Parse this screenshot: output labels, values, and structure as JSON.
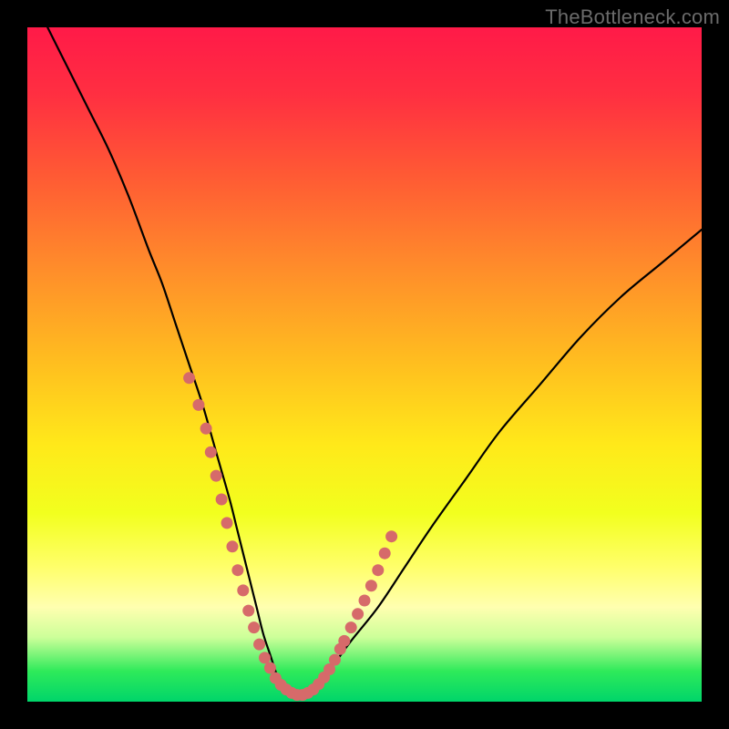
{
  "watermark": "TheBottleneck.com",
  "colors": {
    "frame": "#000000",
    "gradient_stops": [
      {
        "offset": 0.0,
        "color": "#ff1a48"
      },
      {
        "offset": 0.1,
        "color": "#ff2f41"
      },
      {
        "offset": 0.22,
        "color": "#ff5a34"
      },
      {
        "offset": 0.35,
        "color": "#ff8a2b"
      },
      {
        "offset": 0.5,
        "color": "#ffbf1f"
      },
      {
        "offset": 0.62,
        "color": "#ffe91a"
      },
      {
        "offset": 0.72,
        "color": "#f2ff1e"
      },
      {
        "offset": 0.8,
        "color": "#ffff6a"
      },
      {
        "offset": 0.86,
        "color": "#ffffb0"
      },
      {
        "offset": 0.905,
        "color": "#ccff99"
      },
      {
        "offset": 0.955,
        "color": "#2eea5a"
      },
      {
        "offset": 1.0,
        "color": "#00d56a"
      }
    ],
    "curve": "#000000",
    "marker_fill": "#d66a6a",
    "marker_stroke": "#b84f4f"
  },
  "chart_data": {
    "type": "line",
    "title": "",
    "xlabel": "",
    "ylabel": "",
    "xlim": [
      0,
      100
    ],
    "ylim": [
      0,
      100
    ],
    "series": [
      {
        "name": "bottleneck-curve",
        "x": [
          3,
          6,
          9,
          12,
          15,
          18,
          20,
          22,
          24,
          26,
          28,
          30,
          31,
          32,
          33,
          34,
          35,
          36,
          37,
          38,
          39,
          40,
          42,
          45,
          48,
          52,
          56,
          60,
          65,
          70,
          76,
          82,
          88,
          94,
          100
        ],
        "y": [
          100,
          94,
          88,
          82,
          75,
          67,
          62,
          56,
          50,
          44,
          37,
          30,
          26,
          22,
          18,
          14,
          10,
          7,
          4,
          2,
          1,
          1,
          2,
          5,
          9,
          14,
          20,
          26,
          33,
          40,
          47,
          54,
          60,
          65,
          70
        ]
      }
    ],
    "markers": {
      "name": "highlight-dots",
      "x": [
        24.0,
        25.4,
        26.5,
        27.2,
        28.0,
        28.8,
        29.6,
        30.4,
        31.2,
        32.0,
        32.8,
        33.6,
        34.4,
        35.2,
        36.0,
        36.8,
        37.6,
        38.4,
        39.2,
        40.0,
        40.8,
        41.6,
        42.4,
        43.2,
        44.0,
        44.8,
        45.6,
        46.4,
        47.0,
        48.0,
        49.0,
        50.0,
        51.0,
        52.0,
        53.0,
        54.0
      ],
      "y": [
        48.0,
        44.0,
        40.5,
        37.0,
        33.5,
        30.0,
        26.5,
        23.0,
        19.5,
        16.5,
        13.5,
        11.0,
        8.5,
        6.5,
        5.0,
        3.5,
        2.5,
        1.8,
        1.3,
        1.0,
        1.0,
        1.3,
        1.8,
        2.6,
        3.6,
        4.8,
        6.2,
        7.8,
        9.0,
        11.0,
        13.0,
        15.0,
        17.2,
        19.5,
        22.0,
        24.5
      ]
    }
  }
}
